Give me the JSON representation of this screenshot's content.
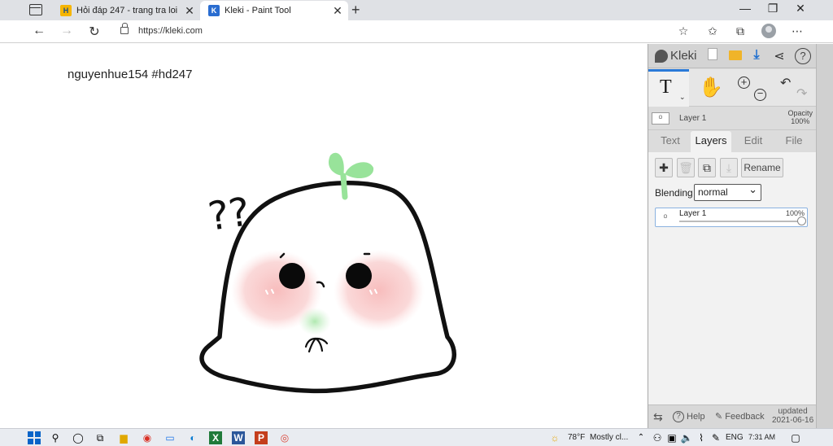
{
  "browser": {
    "tabs": [
      {
        "title": "Hỏi đáp 247 - trang tra loi",
        "favicon": "H",
        "active": false
      },
      {
        "title": "Kleki - Paint Tool",
        "favicon": "K",
        "active": true
      }
    ],
    "url": "https://kleki.com"
  },
  "canvas": {
    "watermark": "nguyenhue154  #hd247",
    "doodle_text": "??"
  },
  "panel": {
    "logo": "Kleki",
    "active_tool": "T",
    "layer_header": {
      "name": "Layer 1",
      "opacity_label": "Opacity",
      "opacity_value": "100%"
    },
    "tabs": [
      "Text",
      "Layers",
      "Edit",
      "File"
    ],
    "active_tab": "Layers",
    "rename_label": "Rename",
    "blending_label": "Blending",
    "blending_value": "normal",
    "layers": [
      {
        "name": "Layer 1",
        "opacity": "100%"
      }
    ],
    "bottom": {
      "help": "Help",
      "feedback": "Feedback",
      "updated_label": "updated",
      "updated_date": "2021-06-16"
    }
  },
  "taskbar": {
    "weather_temp": "78°F",
    "weather_text": "Mostly cl...",
    "language": "ENG",
    "time": "7:31 AM"
  },
  "colors": {
    "accent": "#2a7ad8",
    "sprout": "#9be39a",
    "blush": "#f7c4c4"
  }
}
